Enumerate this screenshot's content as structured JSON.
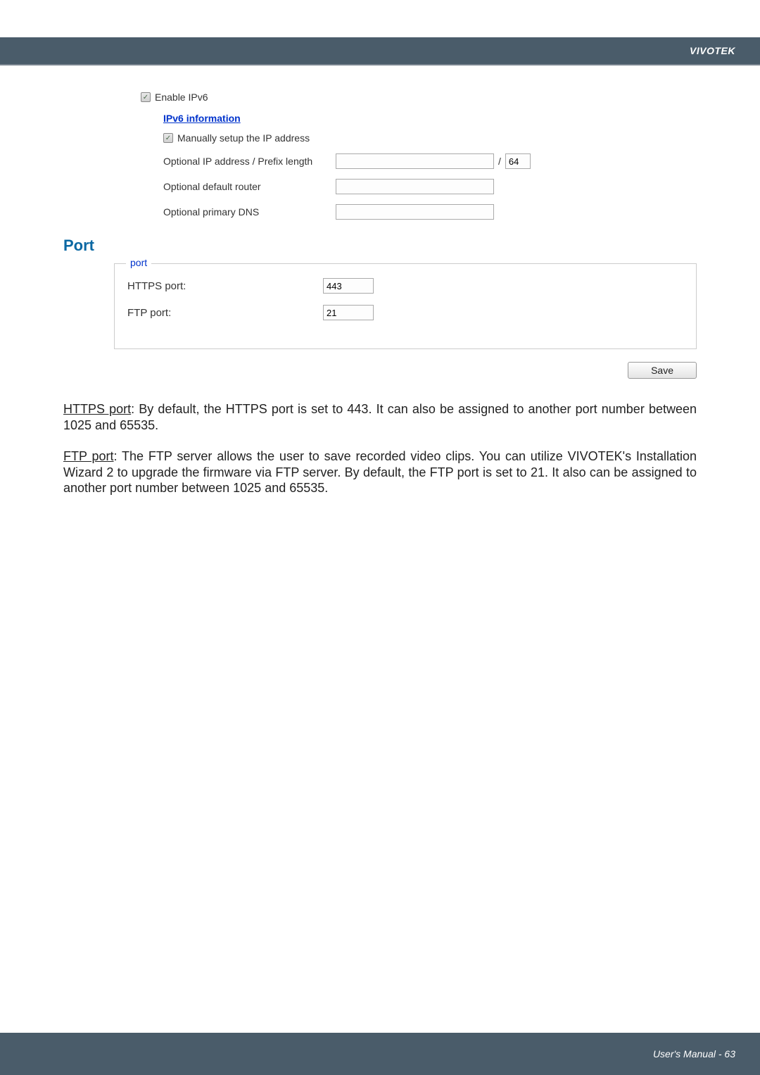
{
  "header": {
    "brand": "VIVOTEK"
  },
  "ipv6": {
    "enable_label": "Enable IPv6",
    "info_link": "IPv6 information",
    "manual_setup_label": "Manually setup the IP address",
    "optional_ip_label": "Optional IP address / Prefix length",
    "optional_ip_value": "",
    "prefix_value": "64",
    "optional_router_label": "Optional default router",
    "optional_router_value": "",
    "optional_dns_label": "Optional primary DNS",
    "optional_dns_value": ""
  },
  "port_section": {
    "heading": "Port",
    "legend": "port",
    "https_label": "HTTPS port:",
    "https_value": "443",
    "ftp_label": "FTP port:",
    "ftp_value": "21"
  },
  "buttons": {
    "save": "Save"
  },
  "body": {
    "https_para_label": "HTTPS port",
    "https_para_text": ": By default, the HTTPS port is set to 443. It can also be assigned to another port number between 1025 and 65535.",
    "ftp_para_label": "FTP port",
    "ftp_para_text": ": The FTP server allows the user to save recorded video clips. You can utilize VIVOTEK's Installation Wizard 2 to upgrade the firmware via FTP server. By default, the FTP port is set to 21. It also can be assigned to another port number between 1025 and 65535."
  },
  "footer": {
    "text": "User's Manual - 63"
  }
}
